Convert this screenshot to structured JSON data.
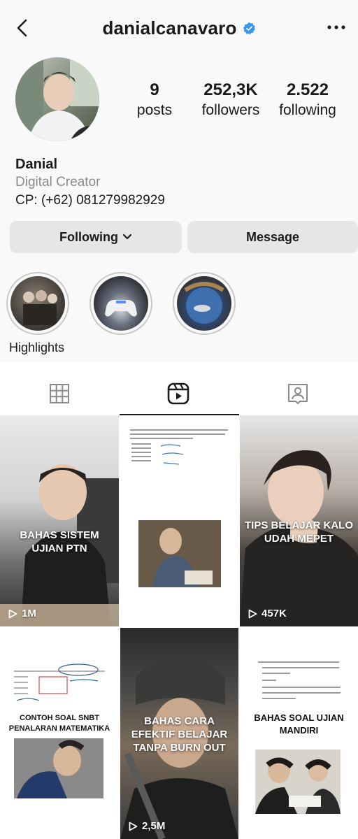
{
  "header": {
    "username": "danialcanavaro"
  },
  "profile": {
    "stats": {
      "posts_count": "9",
      "posts_label": "posts",
      "followers_count": "252,3K",
      "followers_label": "followers",
      "following_count": "2.522",
      "following_label": "following"
    },
    "name": "Danial",
    "category": "Digital Creator",
    "bio": "CP: (+62) 081279982929"
  },
  "actions": {
    "following_label": "Following",
    "message_label": "Message"
  },
  "highlights": {
    "label": "Highlights"
  },
  "icons": {
    "back": "chevron-left-icon",
    "verified": "verified-badge-icon",
    "more": "more-horizontal-icon",
    "grid_tab": "grid-icon",
    "reels_tab": "reels-icon",
    "tagged_tab": "tagged-icon",
    "play": "play-icon"
  },
  "colors": {
    "verified_blue": "#3897f0",
    "button_bg": "#e6e6e6",
    "page_bg": "#f9f9f9"
  },
  "reels": [
    {
      "caption": "BAHAS SISTEM UJIAN PTN",
      "views": "1M"
    },
    {
      "caption": "",
      "views": ""
    },
    {
      "caption": "TIPS BELAJAR KALO UDAH MEPET",
      "views": "457K"
    },
    {
      "caption": "CONTOH SOAL SNBT PENALARAN MATEMATIKA",
      "views": ""
    },
    {
      "caption": "BAHAS CARA EFEKTIF BELAJAR TANPA BURN OUT",
      "views": "2,5M"
    },
    {
      "caption": "BAHAS SOAL UJIAN MANDIRI",
      "views": ""
    }
  ]
}
